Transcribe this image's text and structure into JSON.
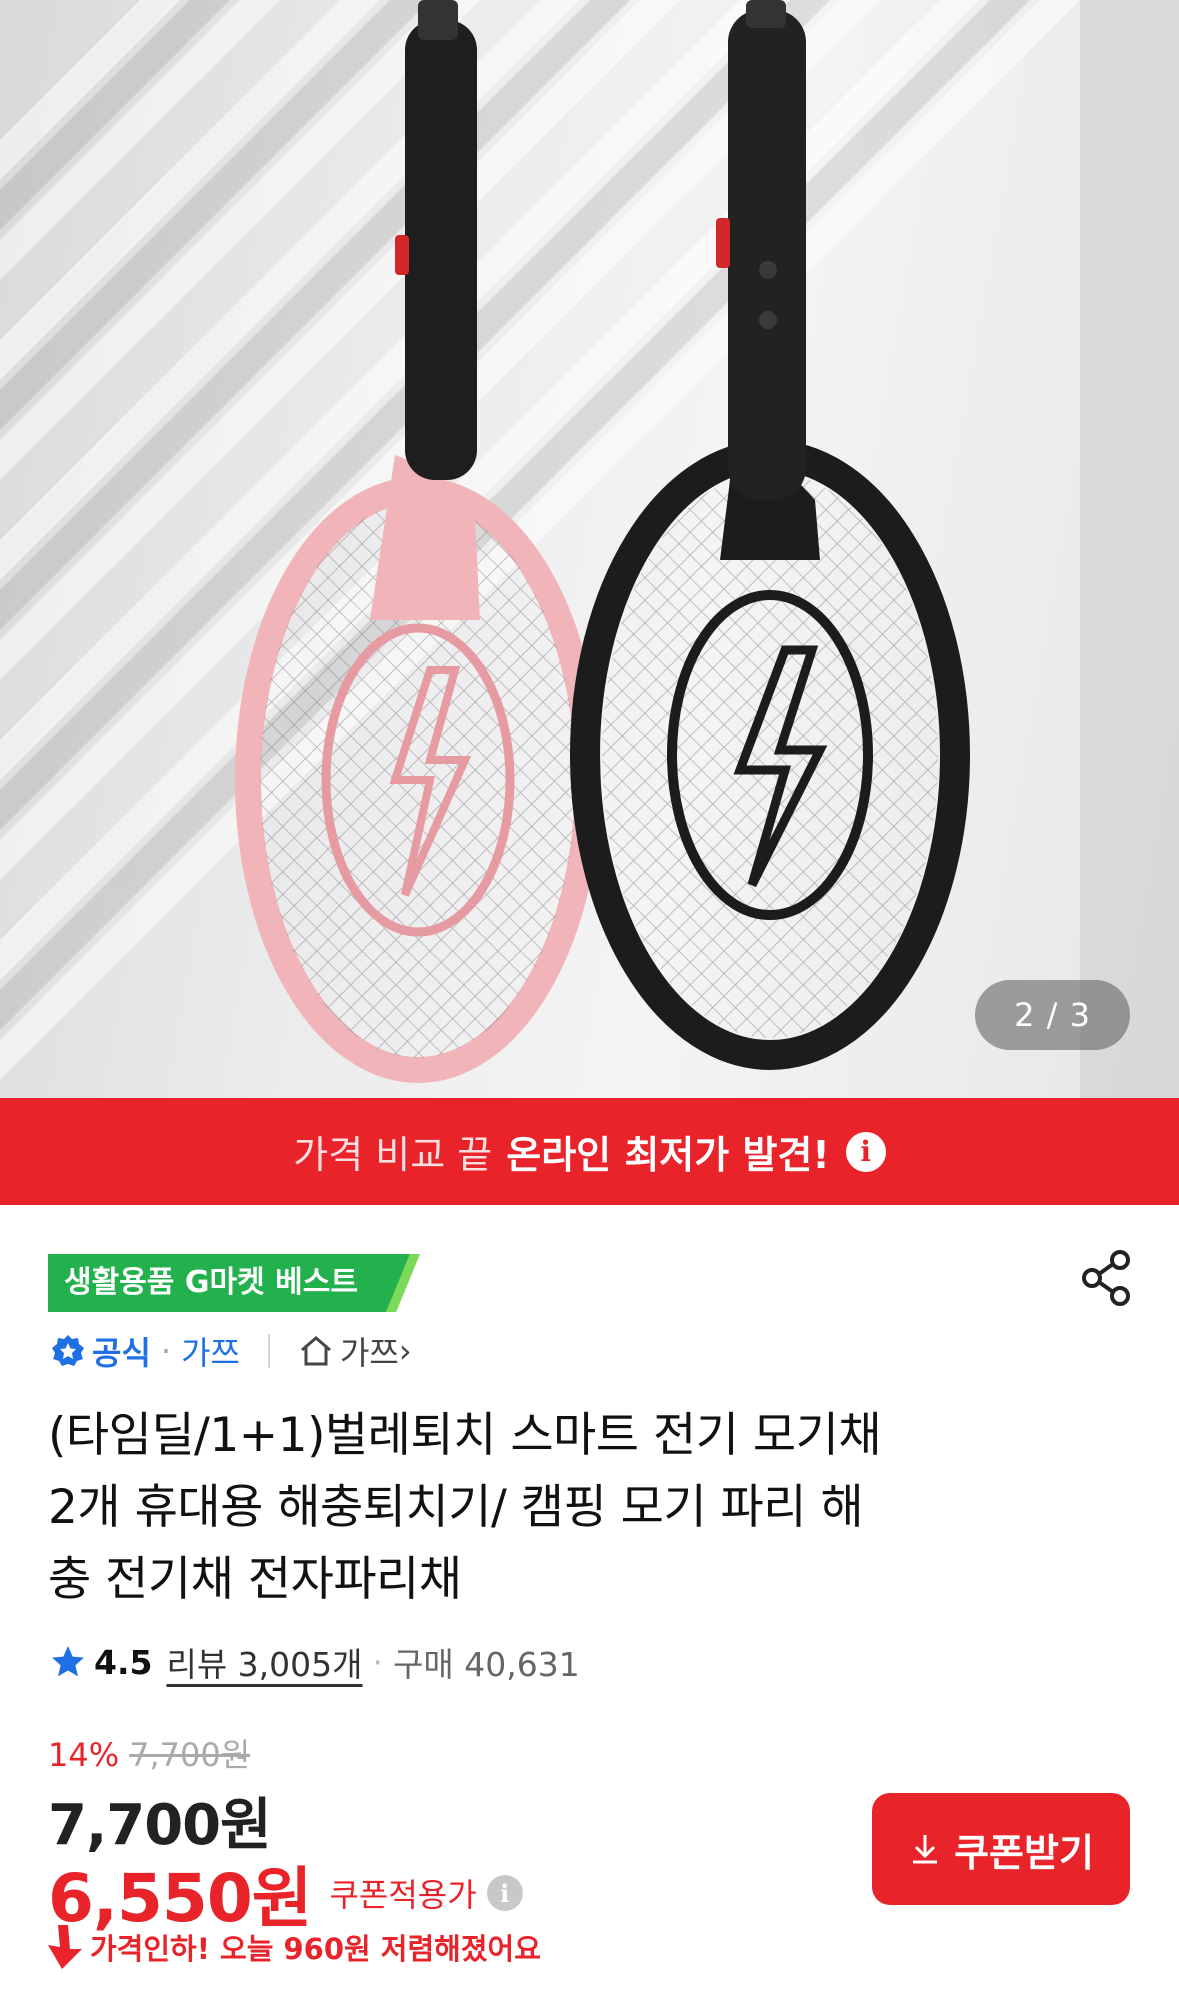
{
  "gallery": {
    "counter": "2 / 3"
  },
  "promo": {
    "light_text": "가격 비교 끝",
    "bold_text": "온라인 최저가 발견!",
    "info_glyph": "i"
  },
  "badge": {
    "best": "생활용품 G마켓 베스트"
  },
  "seller": {
    "official_label": "공식",
    "name": "가쯔",
    "store_link": "가쯔",
    "store_arrow": "›"
  },
  "product": {
    "title_lines": [
      "(타임딜/1+1)벌레퇴치 스마트 전기 모기채",
      "2개 휴대용 해충퇴치기/ 캠핑 모기 파리 해",
      "충 전기채 전자파리채"
    ]
  },
  "rating": {
    "score": "4.5",
    "review": "리뷰 3,005개",
    "purchase": "구매 40,631"
  },
  "price": {
    "discount_pct": "14%",
    "original": "7,700원",
    "sale": "7,700원",
    "coupon_price": "6,550원",
    "coupon_label": "쿠폰적용가",
    "info_glyph": "i",
    "drop_notice": "가격인하! 오늘 960원 저렴해졌어요"
  },
  "buttons": {
    "coupon": "쿠폰받기"
  },
  "colors": {
    "accent": "#e8232a",
    "link": "#1f6fe5",
    "badge_green": "#22b14c"
  }
}
